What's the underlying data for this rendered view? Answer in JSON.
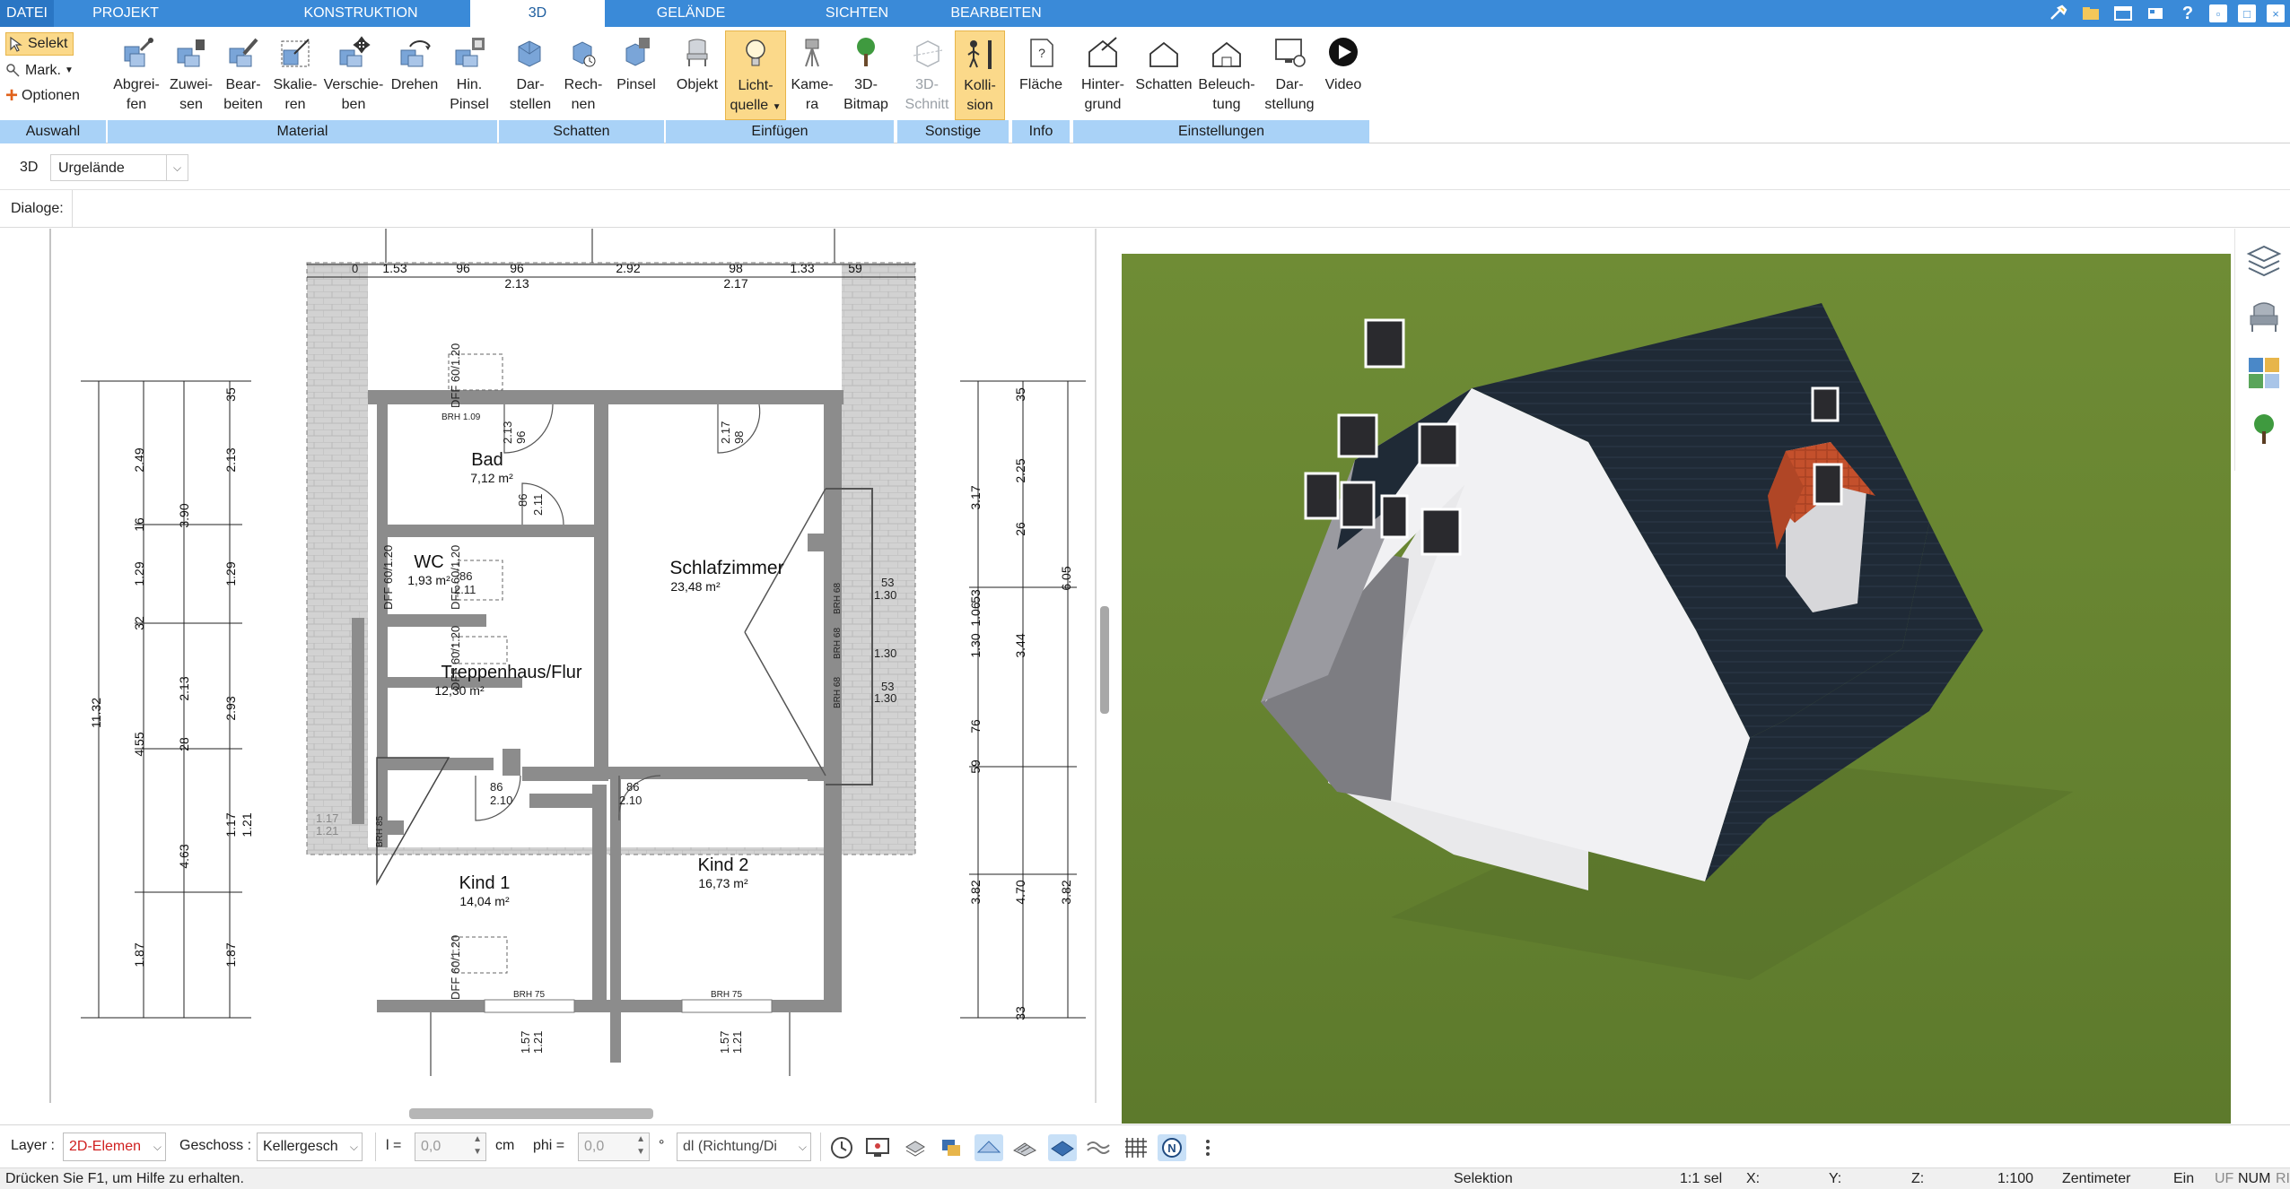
{
  "tabs": {
    "file": "DATEI",
    "projekt": "PROJEKT",
    "konstruktion": "KONSTRUKTION",
    "d3": "3D",
    "gelaende": "GELÄNDE",
    "sichten": "SICHTEN",
    "bearbeiten": "BEARBEITEN"
  },
  "window_controls": {
    "tools_icon": "tools-icon",
    "help": "?",
    "minimize": "▫",
    "maximize": "□",
    "close": "×"
  },
  "ribbon": {
    "auswahl": {
      "selekt": "Selekt",
      "mark": "Mark.",
      "optionen": "Optionen",
      "label": "Auswahl"
    },
    "material": {
      "label": "Material",
      "buttons": [
        {
          "line1": "Abgrei-",
          "line2": "fen",
          "icon": "eyedropper-icon"
        },
        {
          "line1": "Zuwei-",
          "line2": "sen",
          "icon": "assign-icon"
        },
        {
          "line1": "Bear-",
          "line2": "beiten",
          "icon": "edit-material-icon"
        },
        {
          "line1": "Skalie-",
          "line2": "ren",
          "icon": "scale-icon"
        },
        {
          "line1": "Verschie-",
          "line2": "ben",
          "icon": "move-icon"
        },
        {
          "line1": "Drehen",
          "line2": "",
          "icon": "rotate-icon"
        },
        {
          "line1": "Hin.",
          "line2": "Pinsel",
          "icon": "back-brush-icon"
        }
      ]
    },
    "schatten": {
      "label": "Schatten",
      "buttons": [
        {
          "line1": "Dar-",
          "line2": "stellen",
          "icon": "shadow-display-icon"
        },
        {
          "line1": "Rech-",
          "line2": "nen",
          "icon": "shadow-calc-icon"
        },
        {
          "line1": "Pinsel",
          "line2": "",
          "icon": "shadow-brush-icon"
        }
      ]
    },
    "einfuegen": {
      "label": "Einfügen",
      "buttons": [
        {
          "line1": "Objekt",
          "line2": "",
          "icon": "chair-icon"
        },
        {
          "line1": "Licht-",
          "line2": "quelle",
          "icon": "lightbulb-icon"
        },
        {
          "line1": "Kame-",
          "line2": "ra",
          "icon": "camera-icon"
        },
        {
          "line1": "3D-",
          "line2": "Bitmap",
          "icon": "tree-icon"
        }
      ]
    },
    "sonstige": {
      "label": "Sonstige",
      "buttons": [
        {
          "line1": "3D-",
          "line2": "Schnitt",
          "icon": "section-icon"
        },
        {
          "line1": "Kolli-",
          "line2": "sion",
          "icon": "collision-icon"
        }
      ]
    },
    "info": {
      "label": "Info",
      "buttons": [
        {
          "line1": "Fläche",
          "line2": "",
          "icon": "area-icon"
        }
      ]
    },
    "einstellungen": {
      "label": "Einstellungen",
      "buttons": [
        {
          "line1": "Hinter-",
          "line2": "grund",
          "icon": "background-icon"
        },
        {
          "line1": "Schatten",
          "line2": "",
          "icon": "house-shadow-icon"
        },
        {
          "line1": "Beleuch-",
          "line2": "tung",
          "icon": "lighting-icon"
        },
        {
          "line1": "Dar-",
          "line2": "stellung",
          "icon": "display-settings-icon"
        },
        {
          "line1": "Video",
          "line2": "",
          "icon": "play-icon"
        }
      ]
    }
  },
  "row3d": {
    "label": "3D",
    "select_value": "Urgelände"
  },
  "dialoge_label": "Dialoge:",
  "plan": {
    "rooms": [
      {
        "name": "Bad",
        "area": "7,12 m²"
      },
      {
        "name": "WC",
        "area": "1,93 m²"
      },
      {
        "name": "Schlafzimmer",
        "area": "23,48 m²"
      },
      {
        "name": "Treppenhaus/Flur",
        "area": "12,30 m²"
      },
      {
        "name": "Kind 1",
        "area": "14,04 m²"
      },
      {
        "name": "Kind 2",
        "area": "16,73 m²"
      }
    ],
    "top_dims": [
      "1.53",
      "96",
      "96",
      "2.92",
      "98",
      "1.33",
      "59",
      "2.13",
      "2.17"
    ],
    "left_dims": [
      "11.32",
      "3.90",
      "2.49",
      "1.29",
      "2.13",
      "4.55",
      "4.63",
      "1.87",
      "2.13",
      "1.29",
      "2.93",
      "1.17",
      "1.21",
      "1.87",
      "28",
      "32",
      "16",
      "35"
    ],
    "right_dims": [
      "6.05",
      "3.17",
      "2.25",
      "1.30",
      "1.06",
      "3.44",
      "53",
      "76",
      "59",
      "3.82",
      "4.70",
      "3.82",
      "35",
      "26",
      "33"
    ],
    "window_labels": [
      "BRH 1.09",
      "BRH 75",
      "BRH 75",
      "BRH 85",
      "BRH 68",
      "BRH 68",
      "BRH 68"
    ],
    "door_labels": [
      "2.13",
      "86",
      "2.11",
      "86",
      "2.11",
      "86",
      "2.10",
      "86",
      "2.10",
      "98",
      "2.17",
      "96"
    ],
    "dff_labels": [
      "DFF 60/1.20",
      "DFF 60/1.20",
      "DFF 60/1.20",
      "DFF 60/1.20",
      "DFF 60/1.20"
    ],
    "misc": [
      "1.30",
      "1.30",
      "1.30",
      "53",
      "53",
      "1.57",
      "1.21",
      "1.57",
      "1.21",
      "0",
      "1.17",
      "1.21"
    ]
  },
  "palette": [
    {
      "icon": "layers-icon"
    },
    {
      "icon": "armchair-icon"
    },
    {
      "icon": "material-swatch-icon"
    },
    {
      "icon": "plant-icon"
    }
  ],
  "bottombar": {
    "layer_label": "Layer :",
    "layer_value": "2D-Elemen",
    "geschoss_label": "Geschoss :",
    "geschoss_value": "Kellergesch",
    "l_label": "l =",
    "l_value": "0,0",
    "l_unit": "cm",
    "phi_label": "phi =",
    "phi_value": "0,0",
    "phi_unit": "°",
    "dl_value": "dl (Richtung/Di",
    "icons": [
      "clock-icon",
      "monitor-icon",
      "pointcloud-icon",
      "layers-stack-icon",
      "surface-icon",
      "hatch-icon",
      "plane-icon",
      "wave-icon",
      "grid-icon",
      "north-icon",
      "more-icon"
    ]
  },
  "status": {
    "help": "Drücken Sie F1, um Hilfe zu erhalten.",
    "mode": "Selektion",
    "sel": "1:1 sel",
    "x": "X:",
    "y": "Y:",
    "z": "Z:",
    "scale": "1:100",
    "unit": "Zentimeter",
    "ein": "Ein",
    "uf": "UF",
    "num": "NUM",
    "ri": "RI"
  },
  "colors": {
    "accent": "#3a8ad8",
    "group_label_bg": "#a9d2f7",
    "highlight": "#fbd98a",
    "roof": "#1f2a36",
    "wall": "#e8e8ea",
    "grass": "#6a8a34",
    "dormer_roof": "#c4502c"
  }
}
